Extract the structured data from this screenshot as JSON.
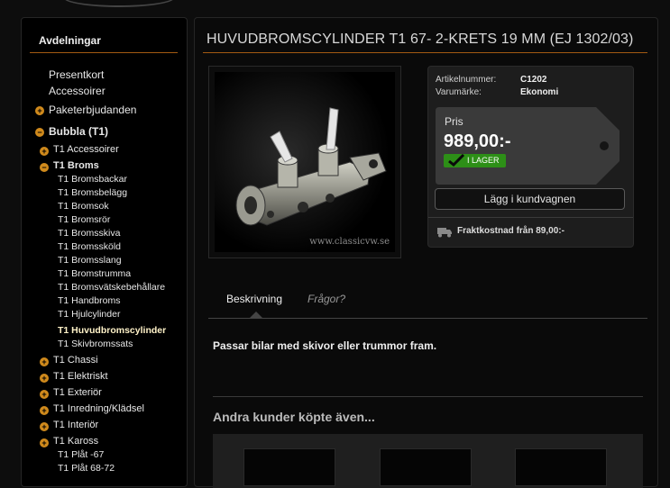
{
  "sidebar": {
    "title": "Avdelningar",
    "items": [
      {
        "label": "Presentkort",
        "bullet": "none",
        "bold": false,
        "active": false
      },
      {
        "label": "Accessoirer",
        "bullet": "none",
        "bold": false,
        "active": false
      },
      {
        "label": "Paketerbjudanden",
        "bullet": "plus",
        "bold": false,
        "active": false
      },
      {
        "label": "Bubbla (T1)",
        "bullet": "minus",
        "bold": true,
        "active": false
      },
      {
        "label": "T1 Accessoirer",
        "bullet": "plus",
        "bold": false,
        "active": false
      },
      {
        "label": "T1 Broms",
        "bullet": "minus",
        "bold": true,
        "active": false
      },
      {
        "label": "T1 Bromsbackar",
        "bullet": "none",
        "bold": false,
        "active": false
      },
      {
        "label": "T1 Bromsbelägg",
        "bullet": "none",
        "bold": false,
        "active": false
      },
      {
        "label": "T1 Bromsok",
        "bullet": "none",
        "bold": false,
        "active": false
      },
      {
        "label": "T1 Bromsrör",
        "bullet": "none",
        "bold": false,
        "active": false
      },
      {
        "label": "T1 Bromsskiva",
        "bullet": "none",
        "bold": false,
        "active": false
      },
      {
        "label": "T1 Bromssköld",
        "bullet": "none",
        "bold": false,
        "active": false
      },
      {
        "label": "T1 Bromsslang",
        "bullet": "none",
        "bold": false,
        "active": false
      },
      {
        "label": "T1 Bromstrumma",
        "bullet": "none",
        "bold": false,
        "active": false
      },
      {
        "label": "T1 Bromsvätskebehållare",
        "bullet": "none",
        "bold": false,
        "active": false
      },
      {
        "label": "T1 Handbroms",
        "bullet": "none",
        "bold": false,
        "active": false
      },
      {
        "label": "T1 Hjulcylinder",
        "bullet": "none",
        "bold": false,
        "active": false
      },
      {
        "label": "T1 Huvudbromscylinder",
        "bullet": "none",
        "bold": true,
        "active": true
      },
      {
        "label": "T1 Skivbromssats",
        "bullet": "none",
        "bold": false,
        "active": false
      },
      {
        "label": "T1 Chassi",
        "bullet": "plus",
        "bold": false,
        "active": false
      },
      {
        "label": "T1 Elektriskt",
        "bullet": "plus",
        "bold": false,
        "active": false
      },
      {
        "label": "T1 Exteriör",
        "bullet": "plus",
        "bold": false,
        "active": false
      },
      {
        "label": "T1 Inredning/Klädsel",
        "bullet": "plus",
        "bold": false,
        "active": false
      },
      {
        "label": "T1 Interiör",
        "bullet": "plus",
        "bold": false,
        "active": false
      },
      {
        "label": "T1 Kaross",
        "bullet": "plus",
        "bold": false,
        "active": false
      },
      {
        "label": "T1 Plåt -67",
        "bullet": "none",
        "bold": false,
        "active": false
      },
      {
        "label": "T1 Plåt 68-72",
        "bullet": "none",
        "bold": false,
        "active": false
      }
    ]
  },
  "product": {
    "title": "HUVUDBROMSCYLINDER T1 67- 2-KRETS 19 MM (EJ 1302/03)",
    "image_watermark": "www.classicvw.se",
    "article_label": "Artikelnummer:",
    "article_value": "C1202",
    "brand_label": "Varumärke:",
    "brand_value": "Ekonomi",
    "price_label": "Pris",
    "price": "989,00:-",
    "stock_label": "I LAGER",
    "cart_button": "Lägg i kundvagnen",
    "shipping_text": "Fraktkostnad från 89,00:-"
  },
  "tabs": {
    "description": "Beskrivning",
    "questions": "Frågor?"
  },
  "description_text": "Passar bilar med skivor eller trummor fram.",
  "others_heading": "Andra kunder köpte även...",
  "colors": {
    "accent_line": "#a35a12",
    "bullet": "#d08a1c",
    "stock_green": "#2d8f17",
    "active_nav": "#fff2c8"
  }
}
